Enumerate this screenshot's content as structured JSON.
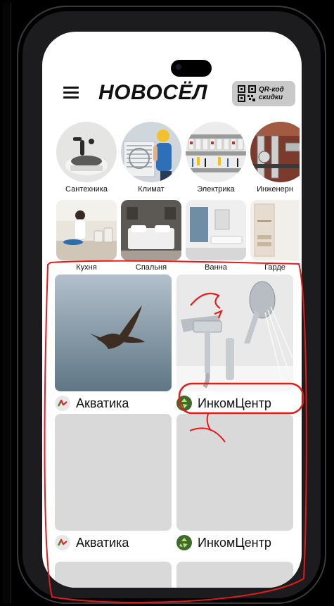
{
  "header": {
    "title": "НОВОСЁЛ",
    "qr": {
      "line1": "QR-код",
      "line2": "скидки"
    }
  },
  "categories": [
    {
      "label": "Сантехника",
      "icon": "faucet-photo"
    },
    {
      "label": "Климат",
      "icon": "ac-installer-photo"
    },
    {
      "label": "Электрика",
      "icon": "electrical-panel-photo"
    },
    {
      "label": "Инженерн",
      "icon": "pipes-photo"
    }
  ],
  "rooms": [
    {
      "label": "Кухня"
    },
    {
      "label": "Спальня"
    },
    {
      "label": "Ванна"
    },
    {
      "label": "Гарде"
    }
  ],
  "feed": [
    {
      "brand": "Акватика",
      "image": "bird-photo"
    },
    {
      "brand": "ИнкомЦентр",
      "image": "shower-photo"
    },
    {
      "brand": "Акватика",
      "image": "placeholder"
    },
    {
      "brand": "ИнкомЦентр",
      "image": "placeholder"
    }
  ],
  "colors": {
    "accent_annotation": "#e21b1b",
    "placeholder": "#d9d9d9",
    "qr_button": "#c9c9c9"
  }
}
